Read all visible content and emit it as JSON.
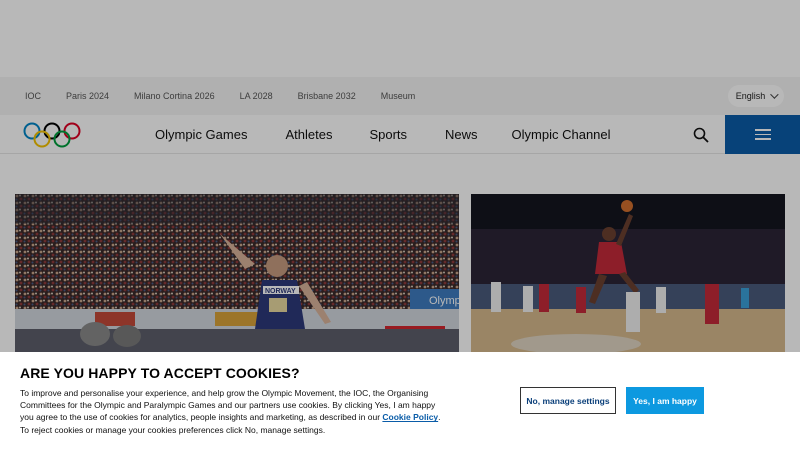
{
  "utility_nav": {
    "links": [
      "IOC",
      "Paris 2024",
      "Milano Cortina 2026",
      "LA 2028",
      "Brisbane 2032",
      "Museum"
    ],
    "language": "English"
  },
  "main_nav": {
    "items": [
      "Olympic Games",
      "Athletes",
      "Sports",
      "News",
      "Olympic Channel"
    ]
  },
  "hero": {
    "left_banner_text": "NORWAY",
    "left_sign_text": "Olympi"
  },
  "cookie": {
    "title": "ARE YOU HAPPY TO ACCEPT COOKIES?",
    "text_before": "To improve and personalise your experience, and help grow the Olympic Movement, the IOC, the Organising Committees for the Olympic and Paralympic Games and our partners use cookies. By clicking Yes, I am happy you agree to the use of cookies for analytics, people insights and marketing, as described in our ",
    "link": "Cookie Policy",
    "text_after": ". To reject cookies or manage your cookies preferences click No, manage settings.",
    "manage_label": "No, manage settings",
    "accept_label": "Yes, I am happy"
  },
  "colors": {
    "brand_blue": "#0a5ca8",
    "accept_blue": "#0d99e0"
  }
}
